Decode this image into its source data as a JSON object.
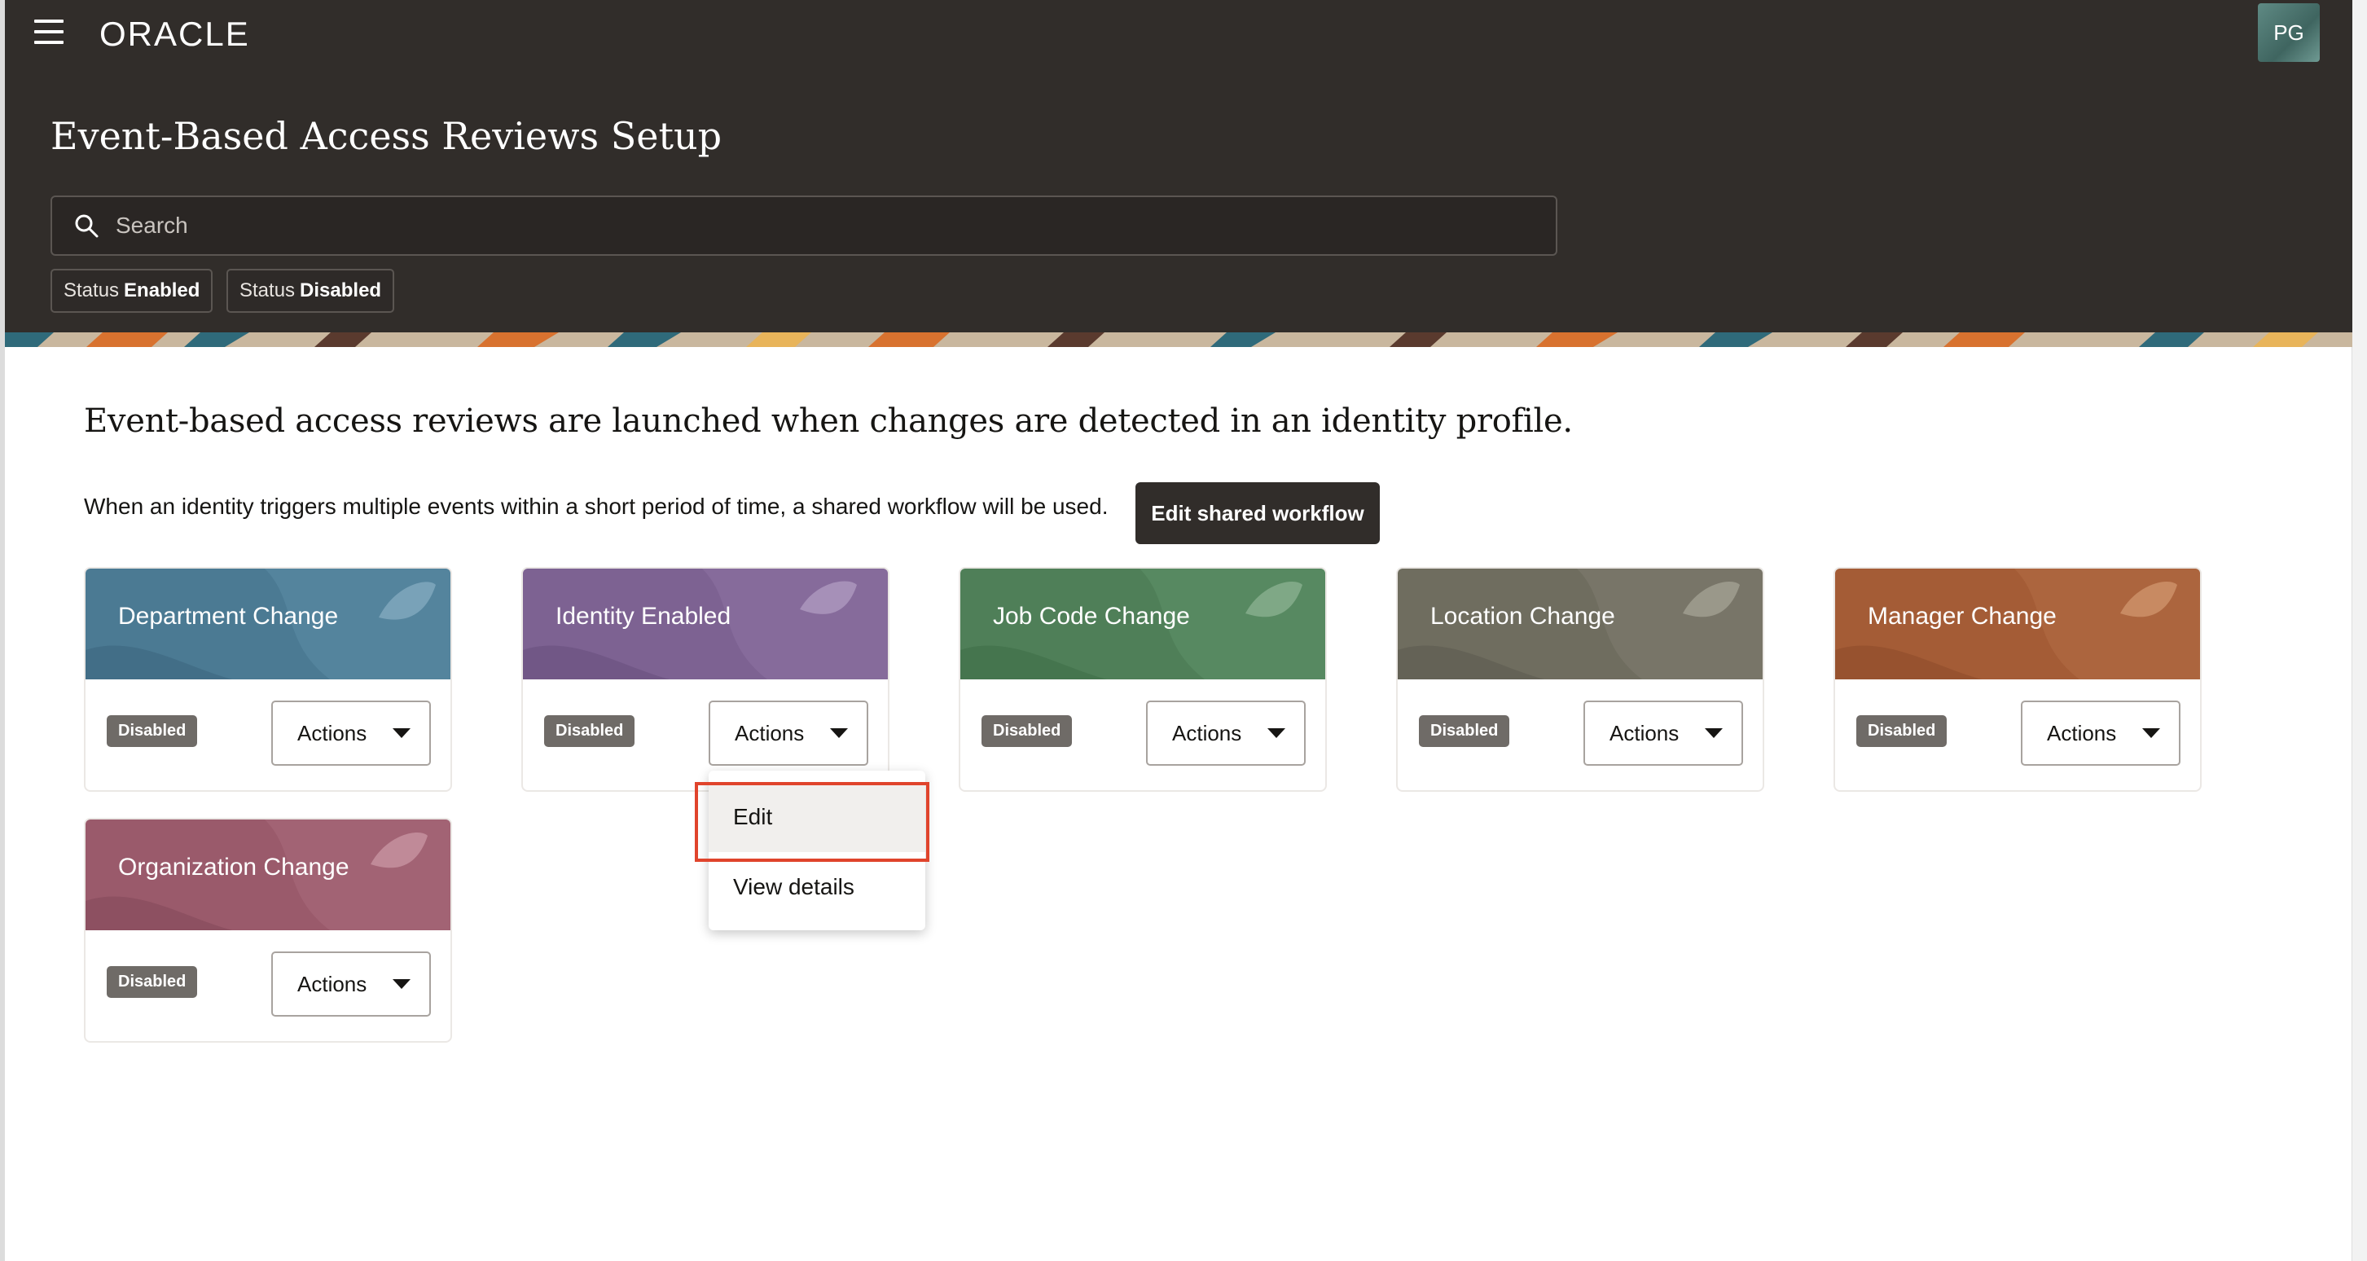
{
  "header": {
    "logo_text": "ORACLE",
    "avatar_initials": "PG",
    "page_title": "Event-Based Access Reviews Setup",
    "search_placeholder": "Search",
    "filters": [
      {
        "label": "Status",
        "value": "Enabled"
      },
      {
        "label": "Status",
        "value": "Disabled"
      }
    ]
  },
  "main": {
    "intro": "Event-based access reviews are launched when changes are detected in an identity profile.",
    "shared_workflow_text": "When an identity triggers multiple events within a short period of time, a shared workflow will be used.",
    "shared_workflow_button": "Edit shared workflow"
  },
  "cards": [
    {
      "title": "Department Change",
      "status": "Disabled",
      "actions_label": "Actions",
      "color": "#4b7a93"
    },
    {
      "title": "Identity Enabled",
      "status": "Disabled",
      "actions_label": "Actions",
      "color": "#7d6292"
    },
    {
      "title": "Job Code Change",
      "status": "Disabled",
      "actions_label": "Actions",
      "color": "#4f7f58"
    },
    {
      "title": "Location Change",
      "status": "Disabled",
      "actions_label": "Actions",
      "color": "#6f6d5f"
    },
    {
      "title": "Manager Change",
      "status": "Disabled",
      "actions_label": "Actions",
      "color": "#a45c36"
    },
    {
      "title": "Organization Change",
      "status": "Disabled",
      "actions_label": "Actions",
      "color": "#9a5a6b"
    }
  ],
  "actions_menu": {
    "items": [
      "Edit",
      "View details"
    ]
  },
  "colors": {
    "header_bg": "#312d2a",
    "highlight": "#e0442c"
  }
}
